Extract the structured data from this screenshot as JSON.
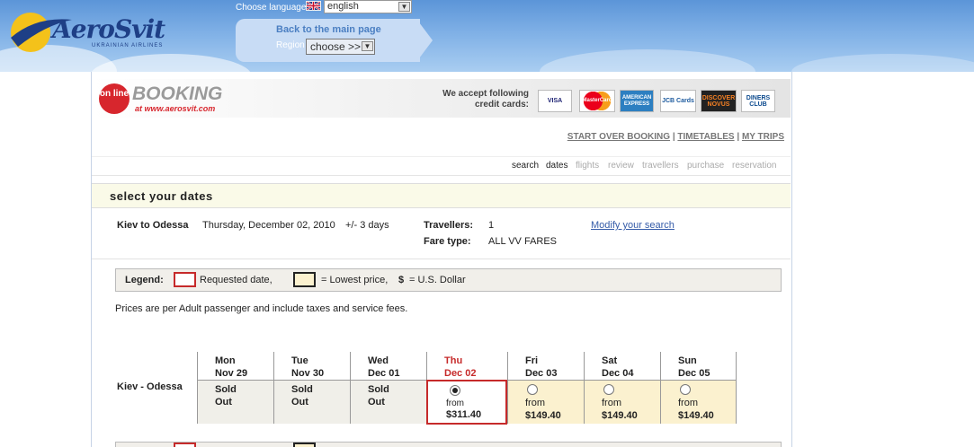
{
  "brand": {
    "name": "AeroSvit",
    "tagline": "UKRAINIAN AIRLINES",
    "booking_title": "BOOKING",
    "booking_url": "at www.aerosvit.com",
    "online_badge": "on line"
  },
  "header": {
    "choose_language_label": "Choose language",
    "language_value": "english",
    "back_link": "Back to the main page",
    "region_label": "Region",
    "region_value": "choose >>"
  },
  "credit_cards": {
    "text": "We accept following credit cards:",
    "cards": [
      "VISA",
      "MasterCard",
      "AMERICAN EXPRESS",
      "JCB Cards",
      "DISCOVER NOVUS",
      "DINERS CLUB"
    ]
  },
  "topnav": {
    "start_over": "START OVER BOOKING",
    "timetables": "TIMETABLES",
    "my_trips": "MY TRIPS",
    "separator": "|"
  },
  "steps": [
    "search",
    "dates",
    "flights",
    "review",
    "travellers",
    "purchase",
    "reservation"
  ],
  "section_title": "select your dates",
  "search_summary": {
    "route": "Kiev to Odessa",
    "date": "Thursday, December 02, 2010",
    "flex": "+/- 3 days",
    "travellers_label": "Travellers:",
    "travellers_value": "1",
    "fare_label": "Fare type:",
    "fare_value": "ALL VV FARES",
    "modify": "Modify your search"
  },
  "legend": {
    "title": "Legend:",
    "requested": "Requested date,",
    "lowest": "= Lowest price,",
    "dollar_symbol": "$",
    "dollar_text": "= U.S. Dollar"
  },
  "price_note": "Prices are per Adult passenger and include taxes and service fees.",
  "calendar": {
    "route": "Kiev - Odessa",
    "days": [
      {
        "dow": "Mon",
        "date": "Nov 29",
        "status": "Sold",
        "status2": "Out"
      },
      {
        "dow": "Tue",
        "date": "Nov 30",
        "status": "Sold",
        "status2": "Out"
      },
      {
        "dow": "Wed",
        "date": "Dec 01",
        "status": "Sold",
        "status2": "Out"
      },
      {
        "dow": "Thu",
        "date": "Dec 02",
        "from": "from",
        "price": "$311.40"
      },
      {
        "dow": "Fri",
        "date": "Dec 03",
        "from": "from",
        "price": "$149.40"
      },
      {
        "dow": "Sat",
        "date": "Dec 04",
        "from": "from",
        "price": "$149.40"
      },
      {
        "dow": "Sun",
        "date": "Dec 05",
        "from": "from",
        "price": "$149.40"
      }
    ]
  },
  "colors": {
    "requested_border": "#c62a2a",
    "lowest_fill": "#fbf1cf",
    "link": "#345ba8"
  }
}
